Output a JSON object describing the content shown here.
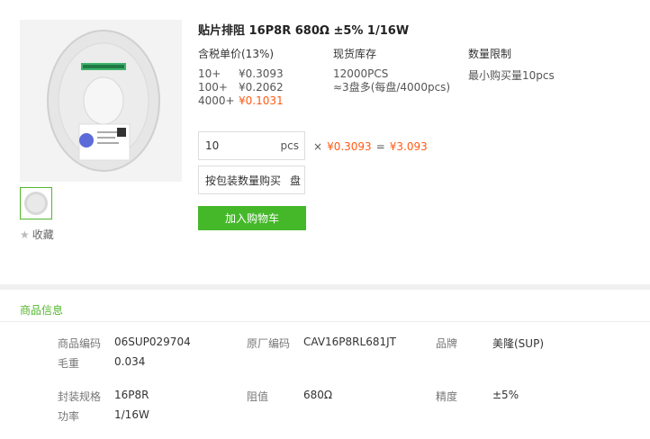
{
  "product": {
    "title": "贴片排阻 16P8R 680Ω ±5% 1/16W",
    "favorite_label": "收藏"
  },
  "pricing": {
    "price_header": "含税单价(13%)",
    "stock_header": "现货库存",
    "limit_header": "数量限制",
    "tiers": [
      {
        "qty": "10+",
        "price": "¥0.3093"
      },
      {
        "qty": "100+",
        "price": "¥0.2062"
      },
      {
        "qty": "4000+",
        "price": "¥0.1031"
      }
    ],
    "stock_line1": "12000PCS",
    "stock_line2": "≈3盘多(每盘/4000pcs)",
    "limit_text": "最小购买量10pcs"
  },
  "purchase": {
    "quantity_value": "10",
    "quantity_unit": "pcs",
    "times_sign": "×",
    "unit_price": "¥0.3093",
    "equals_sign": "=",
    "total": "¥3.093",
    "package_label": "按包装数量购买",
    "package_unit": "盘",
    "add_to_cart": "加入购物车"
  },
  "info": {
    "section_title": "商品信息",
    "row1": [
      {
        "label": "商品编码",
        "value": "06SUP029704"
      },
      {
        "label": "原厂编码",
        "value": "CAV16P8RL681JT"
      },
      {
        "label": "品牌",
        "value": "美隆(SUP)"
      }
    ],
    "weight": {
      "label": "毛重",
      "value": "0.034"
    },
    "row2": [
      {
        "label": "封装规格",
        "value": "16P8R"
      },
      {
        "label": "阻值",
        "value": "680Ω"
      },
      {
        "label": "精度",
        "value": "±5%"
      }
    ],
    "power": {
      "label": "功率",
      "value": "1/16W"
    }
  },
  "colors": {
    "accent_green": "#45b82a",
    "price_orange": "#ff5a14"
  }
}
